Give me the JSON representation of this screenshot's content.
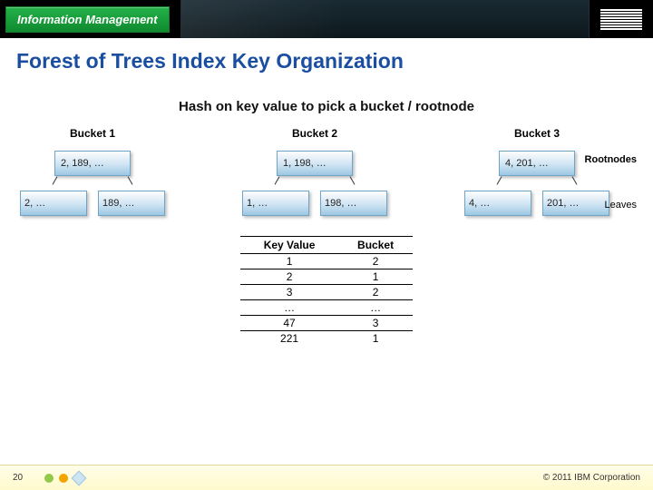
{
  "header": {
    "brand": "Information Management",
    "logo_name": "IBM"
  },
  "title": "Forest of Trees Index Key Organization",
  "hash_heading": "Hash on key value to pick a bucket / rootnode",
  "labels": {
    "rootnodes": "Rootnodes",
    "leaves": "Leaves"
  },
  "buckets": [
    {
      "name": "Bucket 1",
      "rootnode": "2, 189, …",
      "leaves": [
        "2, …",
        "189, …"
      ]
    },
    {
      "name": "Bucket 2",
      "rootnode": "1, 198, …",
      "leaves": [
        "1, …",
        "198, …"
      ]
    },
    {
      "name": "Bucket 3",
      "rootnode": "4, 201, …",
      "leaves": [
        "4, …",
        "201, …"
      ]
    }
  ],
  "table": {
    "headers": [
      "Key Value",
      "Bucket"
    ],
    "rows": [
      [
        "1",
        "2"
      ],
      [
        "2",
        "1"
      ],
      [
        "3",
        "2"
      ],
      [
        "…",
        "…"
      ],
      [
        "47",
        "3"
      ],
      [
        "221",
        "1"
      ]
    ]
  },
  "footer": {
    "page_number": "20",
    "copyright": "© 2011 IBM Corporation"
  }
}
